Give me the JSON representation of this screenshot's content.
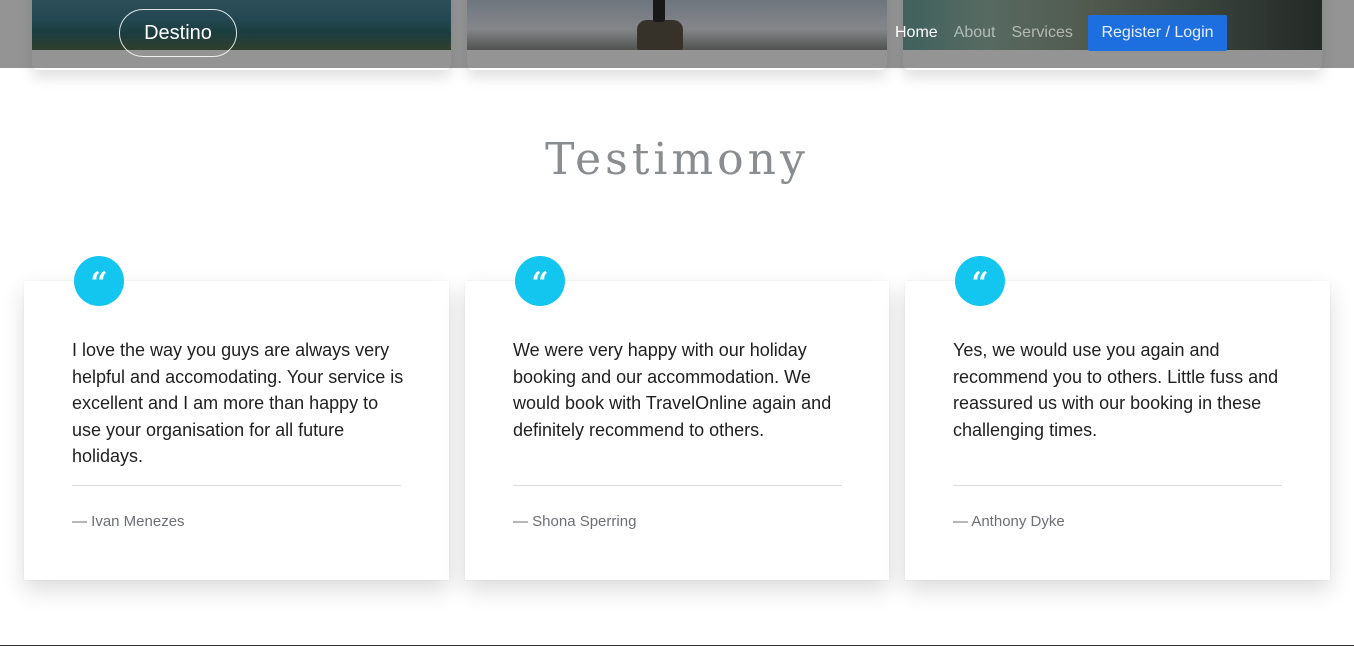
{
  "navbar": {
    "brand": "Destino",
    "links": [
      {
        "label": "Home",
        "active": true
      },
      {
        "label": "About",
        "active": false
      },
      {
        "label": "Services",
        "active": false
      }
    ],
    "cta_label": "Register / Login"
  },
  "section": {
    "title": "Testimony"
  },
  "testimonials": [
    {
      "quote_icon": "quote-left-icon",
      "text": "I love the way you guys are always very helpful and accomodating. Your service is excellent and I am more than happy to use your organisation for all future holidays.",
      "author": "— Ivan Menezes"
    },
    {
      "quote_icon": "quote-left-icon",
      "text": "We were very happy with our holiday booking and our accommodation. We would book with TravelOnline again and definitely recommend to others.",
      "author": "— Shona Sperring"
    },
    {
      "quote_icon": "quote-left-icon",
      "text": "Yes, we would use you again and recommend you to others. Little fuss and reassured us with our booking in these challenging times.",
      "author": "— Anthony Dyke"
    }
  ],
  "colors": {
    "accent": "#13c6ef",
    "cta": "#1d6fe0",
    "heading": "#8a8d90"
  }
}
